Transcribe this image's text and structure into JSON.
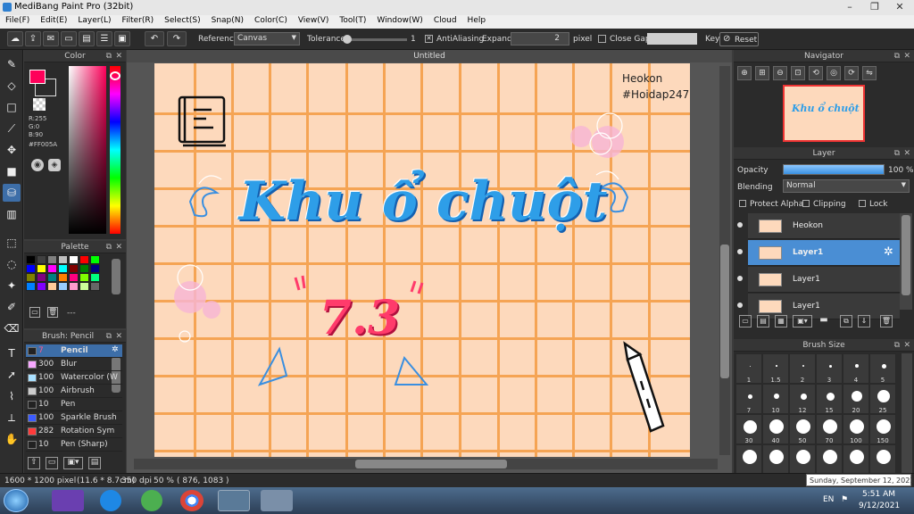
{
  "window": {
    "title": "MediBang Paint Pro (32bit)",
    "minimize": "–",
    "restore": "❐",
    "close": "✕"
  },
  "menu": [
    "File(F)",
    "Edit(E)",
    "Layer(L)",
    "Filter(R)",
    "Select(S)",
    "Snap(N)",
    "Color(C)",
    "View(V)",
    "Tool(T)",
    "Window(W)",
    "Cloud",
    "Help"
  ],
  "toolbar": {
    "reference_label": "Reference",
    "reference_value": "Canvas",
    "tolerance_label": "Tolerance",
    "tolerance_value": "1",
    "antialiasing_label": "AntiAliasing",
    "antialiasing_checked": true,
    "expand_label": "Expand",
    "expand_value": "2",
    "expand_unit": "pixel",
    "close_gaps_label": "Close Gaps",
    "key_label": "Key",
    "reset_label": "Reset"
  },
  "color_panel": {
    "title": "Color",
    "r": "R:255",
    "g": "G:0",
    "b": "B:90",
    "hex": "#FF005A",
    "fg_color": "#ff005a",
    "bg_color": "#ffffff"
  },
  "palette_panel": {
    "title": "Palette",
    "dashes": "---",
    "swatches": [
      "#000000",
      "#404040",
      "#808080",
      "#c0c0c0",
      "#ffffff",
      "#ff0000",
      "#00ff00",
      "#0000ff",
      "#ffff00",
      "#ff00ff",
      "#00ffff",
      "#800000",
      "#008000",
      "#000080",
      "#808000",
      "#800080",
      "#008080",
      "#ff8000",
      "#ff0080",
      "#80ff00",
      "#00ff80",
      "#0080ff",
      "#8000ff",
      "#ffcc99",
      "#99ccff",
      "#ff99cc",
      "#ccff99",
      "#666666"
    ]
  },
  "brush_panel": {
    "title": "Brush: Pencil",
    "items": [
      {
        "size": "7",
        "name": "Pencil",
        "color": "#222222",
        "selected": true
      },
      {
        "size": "300",
        "name": "Blur",
        "color": "#f7a8ff",
        "selected": false
      },
      {
        "size": "100",
        "name": "Watercolor (W",
        "color": "#a8e0ff",
        "selected": false
      },
      {
        "size": "100",
        "name": "Airbrush",
        "color": "#cccccc",
        "selected": false
      },
      {
        "size": "10",
        "name": "Pen",
        "color": "#222222",
        "selected": false
      },
      {
        "size": "100",
        "name": "Sparkle Brush",
        "color": "#3b5bff",
        "selected": false
      },
      {
        "size": "282",
        "name": "Rotation Sym",
        "color": "#ff3b3b",
        "selected": false
      },
      {
        "size": "10",
        "name": "Pen (Sharp)",
        "color": "#222222",
        "selected": false
      }
    ]
  },
  "canvas": {
    "tab_title": "Untitled",
    "signature_name": "Heokon",
    "signature_tag": "#Hoidap247",
    "headline": "Khu ổ chuột",
    "subheadline": "7.3"
  },
  "navigator": {
    "title": "Navigator"
  },
  "layer_panel": {
    "title": "Layer",
    "opacity_label": "Opacity",
    "opacity_value": "100 %",
    "opacity_fraction": 1.0,
    "blending_label": "Blending",
    "blending_value": "Normal",
    "protect_alpha": "Protect Alpha",
    "clipping": "Clipping",
    "lock": "Lock",
    "layers": [
      {
        "name": "Heokon",
        "selected": false
      },
      {
        "name": "Layer1",
        "selected": true
      },
      {
        "name": "Layer1",
        "selected": false
      },
      {
        "name": "Layer1",
        "selected": false
      }
    ]
  },
  "brush_size_panel": {
    "title": "Brush Size",
    "sizes": [
      "1",
      "1.5",
      "2",
      "3",
      "4",
      "5",
      "7",
      "10",
      "12",
      "15",
      "20",
      "25",
      "30",
      "40",
      "50",
      "70",
      "100",
      "150",
      "",
      "",
      "",
      "",
      "",
      ""
    ]
  },
  "status": {
    "dimensions": "1600 * 1200 pixel",
    "physical": "(11.6 * 8.7cm)",
    "dpi": "350 dpi",
    "zoom": "50 %",
    "coords": "( 876, 1083 )"
  },
  "taskbar": {
    "tooltip": "Sunday, September 12, 2021",
    "lang": "EN",
    "time": "5:51 AM",
    "date": "9/12/2021"
  }
}
